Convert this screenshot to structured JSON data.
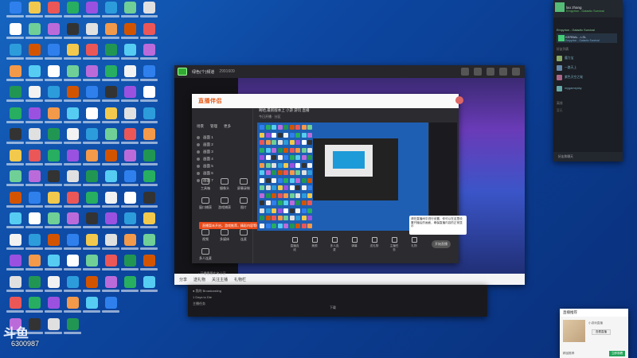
{
  "desktop": {
    "icon_colors": [
      "#2f80ed",
      "#f2c94c",
      "#eb5757",
      "#27ae60",
      "#9b51e0",
      "#f2994a",
      "#56ccf2",
      "#ffffff",
      "#6fcf97",
      "#bb6bd9",
      "#333333",
      "#e0e0e0",
      "#219653",
      "#f2f2f2",
      "#2d9cdb",
      "#d35400"
    ]
  },
  "stream_window": {
    "title": "绿色(个)频道",
    "id": "2991609",
    "bottom_items": [
      "分享",
      "送礼物",
      "关注主播",
      "礼物栏"
    ]
  },
  "broadcaster": {
    "logo": "直播伴侣",
    "scene_tabs": [
      "场景",
      "管理",
      "更多"
    ],
    "scenes": [
      "画面 1",
      "画面 2",
      "画面 3",
      "画面 4",
      "画面 5",
      "画面 6",
      "画面 7"
    ],
    "room_title": "啊哈,最新版本上 小游 游玩 直播",
    "room_meta": "今日开播 · 分区",
    "tools": [
      "工具箱",
      "摄像头",
      "屏幕录制",
      "窗口捕获",
      "游戏捕获",
      "图片",
      "视频",
      "多媒体",
      "连麦",
      "多人连麦"
    ],
    "warning": "直播暂未开启，游戏推荐，精彩内容等你来体验",
    "hint": "• 开播需要实名认证",
    "bottom_tools": [
      "直播连线",
      "美颜",
      "多人连麦",
      "弹幕",
      "送礼物",
      "主播任务",
      "礼物"
    ],
    "start_label": "开始直播",
    "tooltip": "请在直播间中进行设置，你可以在这里设置开播后的画面，确保直播内容的正常显示"
  },
  "steam_friends": {
    "user_name": "lao zhang",
    "user_status": "Empyrion - Galactic Survival",
    "game_line": "Empyrion - Galactic Survival",
    "group_name": "KERBAL - LSL",
    "group_sub": "Empyrion - Galactic Survival",
    "section_friends": "好友列表",
    "friends": [
      {
        "name": "魔力宝",
        "color": "#8a6"
      },
      {
        "name": "一路天上",
        "color": "#68a"
      },
      {
        "name": "紫色天空之城",
        "color": "#a68"
      },
      {
        "name": "mygameplay",
        "color": "#6aa"
      }
    ],
    "section_offline": "离线",
    "offline_friend": "暂无",
    "footer": "好友和聊天"
  },
  "mini_window": {
    "items": [
      "● 我的 Broadcasting",
      "1 Days to Die",
      "主播任务"
    ],
    "center": "下载"
  },
  "promo": {
    "title": "直播推荐",
    "text": "小游戏直播",
    "button": "查看直播",
    "footer": "精品推荐",
    "go": "立即观看"
  },
  "watermark": {
    "logo": "斗鱼",
    "room_id": "6300987"
  }
}
